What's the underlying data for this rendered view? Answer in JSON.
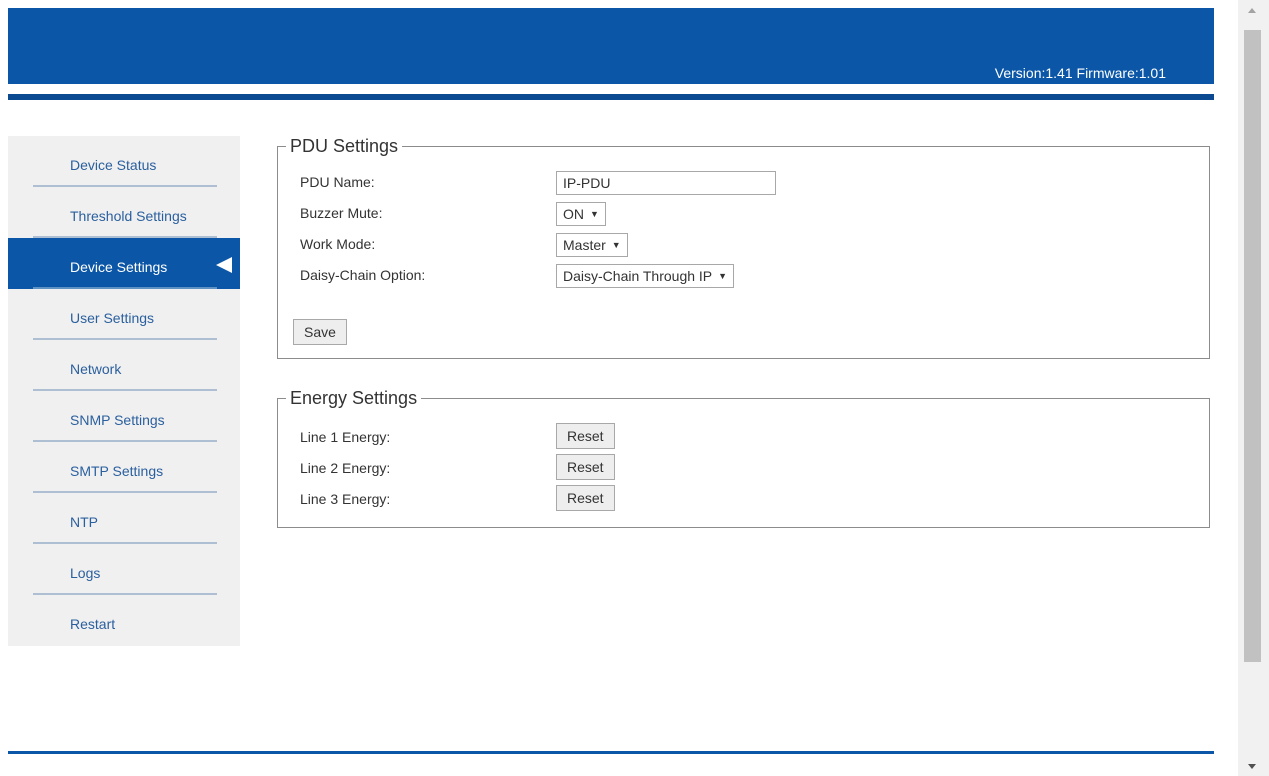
{
  "header": {
    "version_text": "Version:1.41 Firmware:1.01"
  },
  "sidebar": {
    "items": [
      {
        "label": "Device Status"
      },
      {
        "label": "Threshold Settings"
      },
      {
        "label": "Device Settings",
        "active": true
      },
      {
        "label": "User Settings"
      },
      {
        "label": "Network"
      },
      {
        "label": "SNMP Settings"
      },
      {
        "label": "SMTP Settings"
      },
      {
        "label": "NTP"
      },
      {
        "label": "Logs"
      },
      {
        "label": "Restart"
      }
    ]
  },
  "pdu_settings": {
    "legend": "PDU Settings",
    "pdu_name_label": "PDU Name:",
    "pdu_name_value": "IP-PDU",
    "buzzer_mute_label": "Buzzer Mute:",
    "buzzer_mute_value": "ON",
    "work_mode_label": "Work Mode:",
    "work_mode_value": "Master",
    "daisy_chain_label": "Daisy-Chain Option:",
    "daisy_chain_value": "Daisy-Chain Through IP",
    "save_label": "Save"
  },
  "energy_settings": {
    "legend": "Energy Settings",
    "lines": [
      {
        "label": "Line 1 Energy:",
        "button": "Reset"
      },
      {
        "label": "Line 2 Energy:",
        "button": "Reset"
      },
      {
        "label": "Line 3 Energy:",
        "button": "Reset"
      }
    ]
  },
  "icons": {
    "active_nav_marker": "triangle-left-icon",
    "select_caret": "caret-down-icon",
    "scroll_up": "scroll-up-arrow-icon",
    "scroll_down": "scroll-down-arrow-icon"
  },
  "colors": {
    "header_blue": "#0b56a7",
    "nav_text": "#2a5f9e",
    "sidebar_bg": "#f0f0f0"
  }
}
